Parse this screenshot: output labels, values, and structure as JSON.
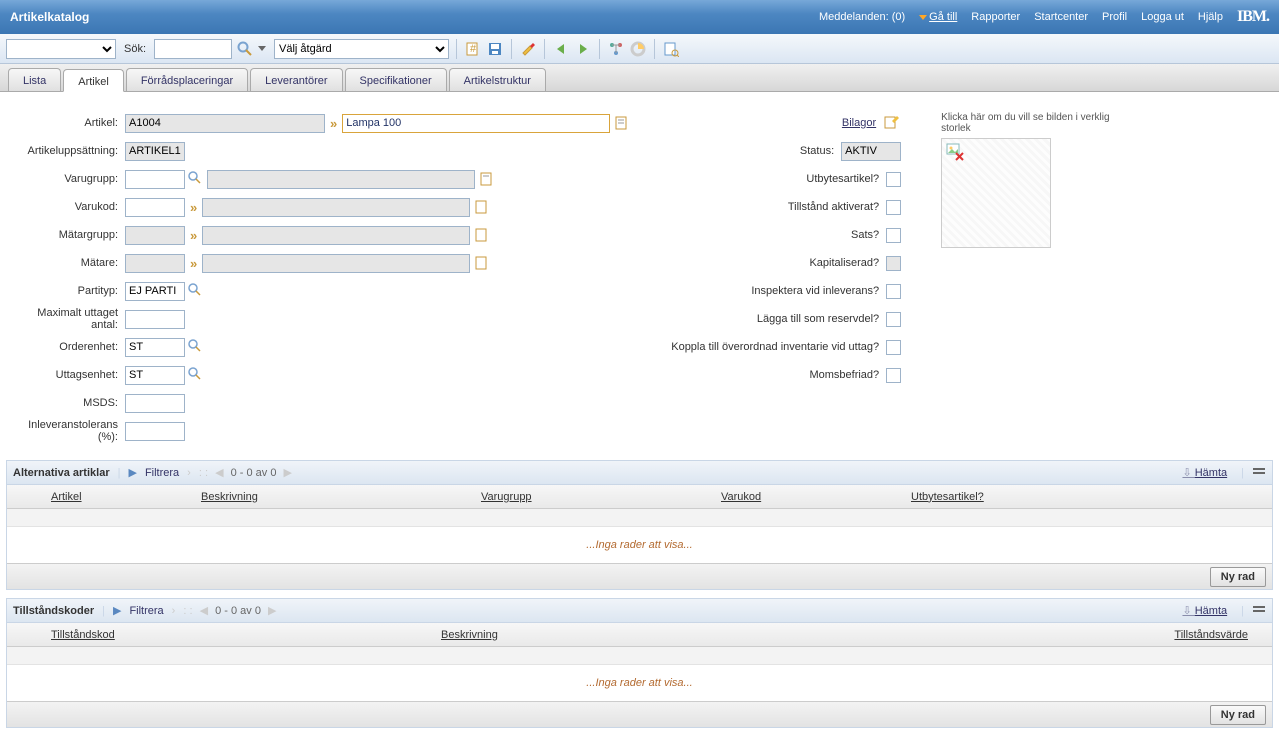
{
  "header": {
    "title": "Artikelkatalog",
    "messages": "Meddelanden: (0)",
    "goto": "Gå till",
    "links": [
      "Rapporter",
      "Startcenter",
      "Profil",
      "Logga ut",
      "Hjälp"
    ],
    "ibm": "IBM."
  },
  "toolbar": {
    "search_label": "Sök:",
    "action_default": "Välj åtgärd"
  },
  "tabs": [
    "Lista",
    "Artikel",
    "Förrådsplaceringar",
    "Leverantörer",
    "Specifikationer",
    "Artikelstruktur"
  ],
  "active_tab": 1,
  "form": {
    "artikel_label": "Artikel:",
    "artikel": "A1004",
    "artikel_desc": "Lampa 100",
    "artikelupps_label": "Artikeluppsättning:",
    "artikelupps": "ARTIKEL1",
    "varugrupp_label": "Varugrupp:",
    "varugrupp": "",
    "varugrupp_desc": "",
    "varukod_label": "Varukod:",
    "varukod": "",
    "varukod_desc": "",
    "matargrupp_label": "Mätargrupp:",
    "matargrupp": "",
    "matargrupp_desc": "",
    "matare_label": "Mätare:",
    "matare": "",
    "matare_desc": "",
    "partityp_label": "Partityp:",
    "partityp": "EJ PARTI",
    "max_uttag_label": "Maximalt uttaget antal:",
    "max_uttag": "",
    "orderenhet_label": "Orderenhet:",
    "orderenhet": "ST",
    "uttagsenhet_label": "Uttagsenhet:",
    "uttagsenhet": "ST",
    "msds_label": "MSDS:",
    "msds": "",
    "inlev_label": "Inleveranstolerans (%):",
    "inlev": ""
  },
  "right": {
    "bilagor": "Bilagor",
    "status_label": "Status:",
    "status": "AKTIV",
    "chk1": "Utbytesartikel?",
    "chk2": "Tillstånd aktiverat?",
    "chk3": "Sats?",
    "chk4": "Kapitaliserad?",
    "chk5": "Inspektera vid inleverans?",
    "chk6": "Lägga till som reservdel?",
    "chk7": "Koppla till överordnad inventarie vid uttag?",
    "chk8": "Momsbefriad?"
  },
  "image_hint": "Klicka här om du vill se bilden i verklig storlek",
  "sect1": {
    "title": "Alternativa artiklar",
    "filter": "Filtrera",
    "page": "0 - 0 av 0",
    "cols": [
      "Artikel",
      "Beskrivning",
      "Varugrupp",
      "Varukod",
      "Utbytesartikel?"
    ],
    "empty": "...Inga rader att visa...",
    "newrow": "Ny rad",
    "hamta": "Hämta"
  },
  "sect2": {
    "title": "Tillståndskoder",
    "filter": "Filtrera",
    "page": "0 - 0 av 0",
    "cols": [
      "Tillståndskod",
      "Beskrivning",
      "Tillståndsvärde"
    ],
    "empty": "...Inga rader att visa...",
    "newrow": "Ny rad",
    "hamta": "Hämta"
  }
}
